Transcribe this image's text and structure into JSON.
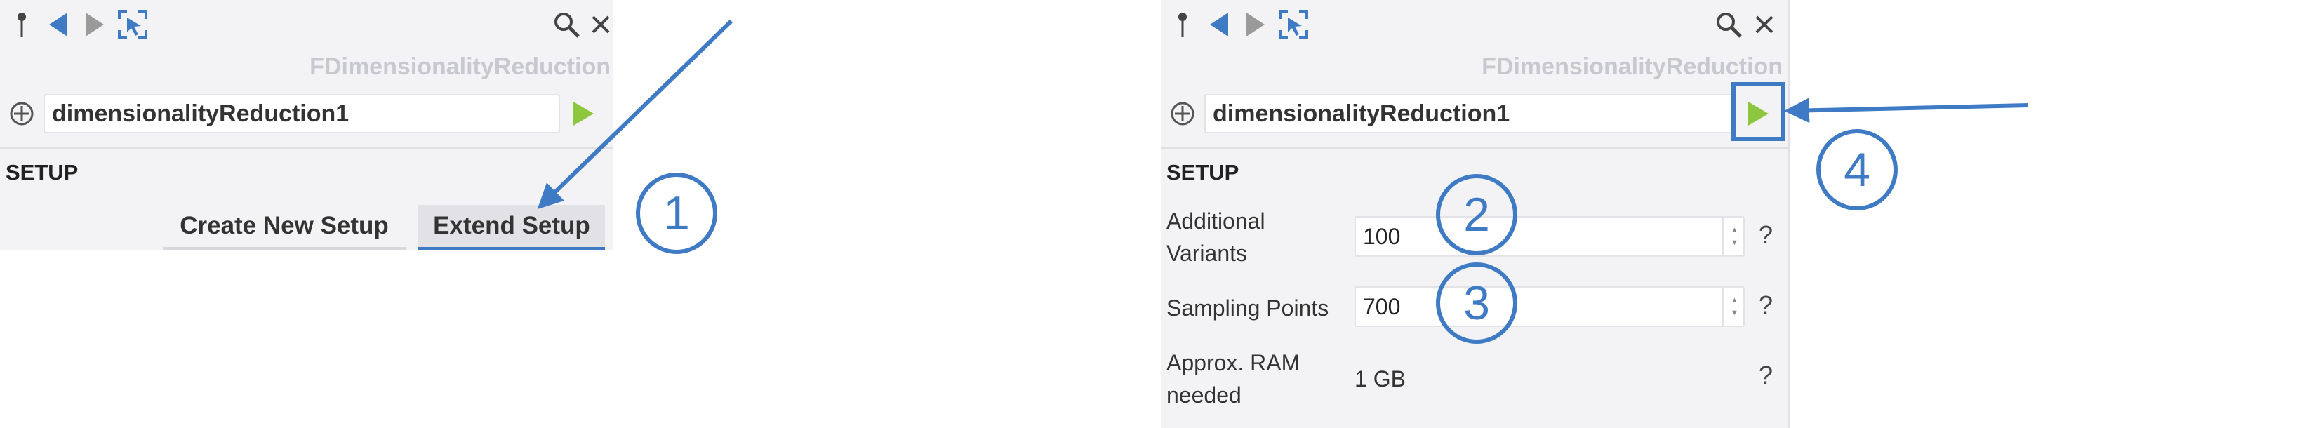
{
  "left_panel": {
    "system_name": "FDimensionalityReduction",
    "component_name": "dimensionalityReduction1",
    "section_title": "SETUP",
    "buttons": {
      "create": "Create New Setup",
      "extend": "Extend Setup"
    }
  },
  "right_panel": {
    "system_name": "FDimensionalityReduction",
    "component_name": "dimensionalityReduction1",
    "section_title": "SETUP",
    "fields": {
      "additional_variants": {
        "label_line1": "Additional",
        "label_line2": "Variants",
        "value": "100",
        "help": "?"
      },
      "sampling_points": {
        "label": "Sampling Points",
        "value": "700",
        "help": "?"
      },
      "ram": {
        "label_line1": "Approx. RAM",
        "label_line2": "needed",
        "value": "1 GB",
        "help": "?"
      }
    }
  },
  "callouts": [
    "1",
    "2",
    "3",
    "4"
  ],
  "colors": {
    "accent_blue": "#3f7bc4",
    "run_green": "#8dc63f",
    "panel_bg": "#f3f3f5"
  },
  "icons": [
    "pin-icon",
    "back-arrow-icon",
    "forward-arrow-icon",
    "select-target-icon",
    "search-icon",
    "close-icon",
    "add-circle-icon",
    "run-icon"
  ]
}
